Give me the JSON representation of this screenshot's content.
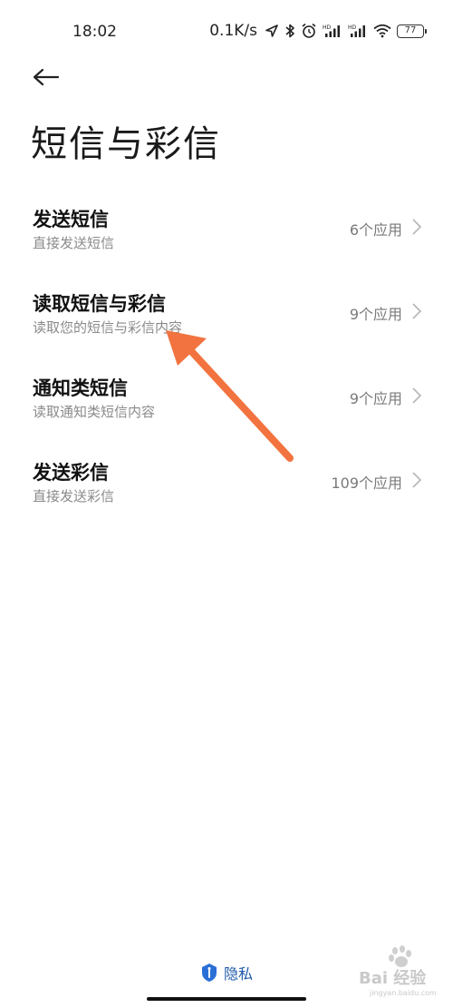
{
  "status_bar": {
    "time": "18:02",
    "net_speed": "0.1K/s",
    "battery": "77"
  },
  "header": {
    "title": "短信与彩信"
  },
  "items": [
    {
      "title": "发送短信",
      "subtitle": "直接发送短信",
      "count": "6个应用"
    },
    {
      "title": "读取短信与彩信",
      "subtitle": "读取您的短信与彩信内容",
      "count": "9个应用"
    },
    {
      "title": "通知类短信",
      "subtitle": "读取通知类短信内容",
      "count": "9个应用"
    },
    {
      "title": "发送彩信",
      "subtitle": "直接发送彩信",
      "count": "109个应用"
    }
  ],
  "footer": {
    "privacy_label": "隐私"
  },
  "watermark": {
    "main": "Bai 经验",
    "sub": "jingyan.baidu.com"
  },
  "colors": {
    "annotation_arrow": "#f2733f",
    "privacy_accent": "#1e5aa8"
  }
}
